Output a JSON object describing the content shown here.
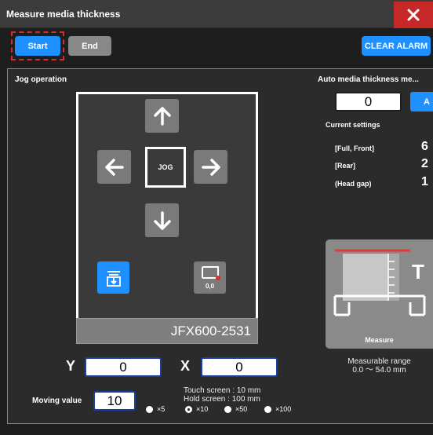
{
  "window": {
    "title": "Measure media thickness"
  },
  "toolbar": {
    "start_label": "Start",
    "end_label": "End",
    "clear_alarm_label": "CLEAR ALARM"
  },
  "jog": {
    "section_label": "Jog operation",
    "center_label": "JOG",
    "origin_label": "0,0",
    "model_name": "JFX600-2531"
  },
  "position": {
    "y_label": "Y",
    "y_value": "0",
    "x_label": "X",
    "x_value": "0"
  },
  "moving": {
    "label": "Moving value",
    "value": "10",
    "touch_text": "Touch screen : 10 mm",
    "hold_text": "Hold screen : 100 mm",
    "options": [
      {
        "label": "×5",
        "selected": false
      },
      {
        "label": "×10",
        "selected": true
      },
      {
        "label": "×50",
        "selected": false
      },
      {
        "label": "×100",
        "selected": false
      }
    ]
  },
  "auto": {
    "section_label": "Auto media thickness me...",
    "value": "0",
    "button_label": "A",
    "current_settings_label": "Current settings",
    "rows": [
      {
        "label": "[Full, Front]",
        "value": "6"
      },
      {
        "label": "[Rear]",
        "value": "2"
      },
      {
        "label": "(Head gap)",
        "value": "1"
      }
    ]
  },
  "measure": {
    "button_label": "Measure",
    "range_label": "Measurable range",
    "range_value": "0.0 〜 54.0 mm"
  },
  "colors": {
    "accent": "#1e90ff",
    "close": "#c62828",
    "field_border": "#1a3fa0"
  }
}
